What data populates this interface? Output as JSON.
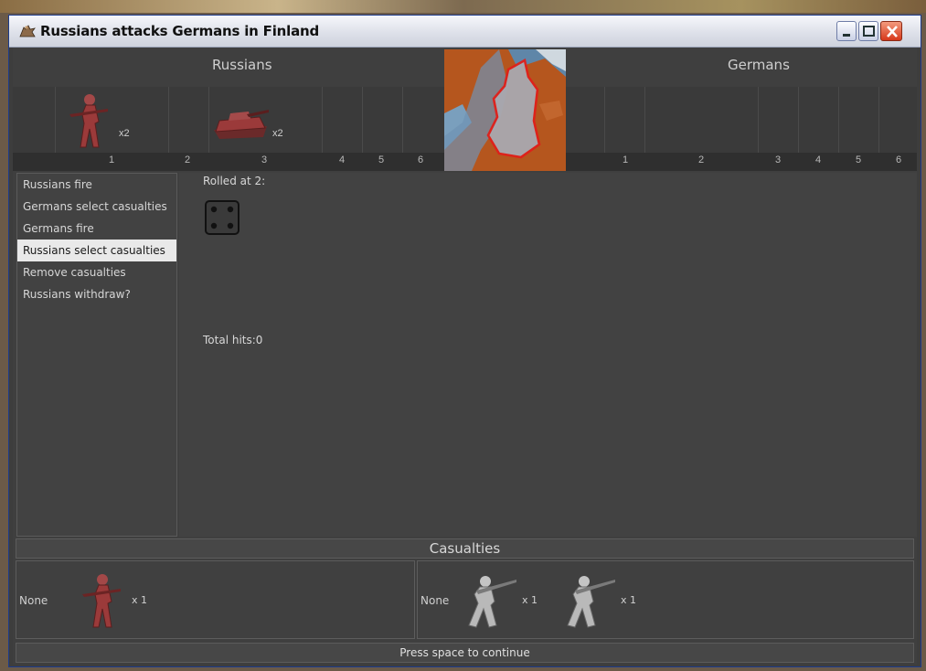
{
  "window": {
    "title": "Russians attacks Germans in Finland"
  },
  "colors": {
    "russian_unit": "#9b3a3a",
    "german_unit": "#b9b9b9",
    "panel": "#3f3f3f",
    "active_step_bg": "#e9e9e9"
  },
  "attacker": {
    "name": "Russians",
    "units": [
      {
        "icon": "soldier-icon",
        "count": "x2",
        "column": 1
      },
      {
        "icon": "tank-icon",
        "count": "x2",
        "column": 3
      }
    ],
    "columns": [
      "1",
      "2",
      "3",
      "4",
      "5",
      "6"
    ]
  },
  "defender": {
    "name": "Germans",
    "units": [],
    "columns": [
      "1",
      "2",
      "3",
      "4",
      "5",
      "6"
    ]
  },
  "territory_map": {
    "icon": "finland-map-icon"
  },
  "steps": [
    {
      "label": "Russians fire",
      "active": false
    },
    {
      "label": "Germans select casualties",
      "active": false
    },
    {
      "label": "Germans fire",
      "active": false
    },
    {
      "label": "Russians select casualties",
      "active": true
    },
    {
      "label": "Remove casualties",
      "active": false
    },
    {
      "label": "Russians withdraw?",
      "active": false
    }
  ],
  "roll": {
    "label": "Rolled at 2:",
    "dice": [
      4
    ],
    "total_label": "Total hits:0"
  },
  "casualties": {
    "title": "Casualties",
    "attacker": {
      "none_label": "None",
      "units": [
        {
          "icon": "soldier-icon",
          "count": "x 1"
        }
      ]
    },
    "defender": {
      "none_label": "None",
      "units": [
        {
          "icon": "german-soldier-icon",
          "count": "x 1"
        },
        {
          "icon": "german-soldier-icon",
          "count": "x 1"
        }
      ]
    }
  },
  "status": "Press space to continue"
}
